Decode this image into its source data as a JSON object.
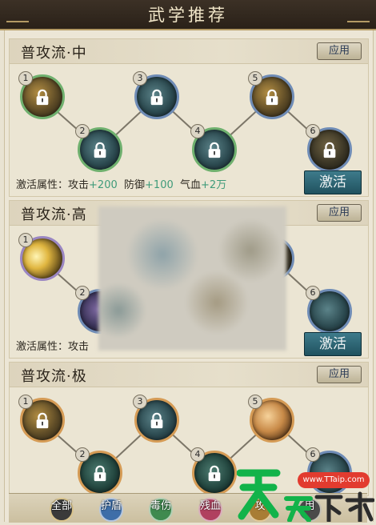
{
  "window": {
    "title": "武学推荐"
  },
  "sections": [
    {
      "title": "普攻流·中",
      "apply_label": "应用",
      "nodes": [
        "1",
        "2",
        "3",
        "4",
        "5",
        "6"
      ],
      "attr_label": "激活属性：",
      "attr_parts": [
        "攻击",
        "+200",
        "防御",
        "+100",
        "气血",
        "+2万"
      ],
      "activate_label": "激活"
    },
    {
      "title": "普攻流·高",
      "apply_label": "应用",
      "nodes": [
        "1",
        "2",
        "6"
      ],
      "attr_label": "激活属性：攻击",
      "activate_label": "激活"
    },
    {
      "title": "普攻流·极",
      "apply_label": "应用",
      "nodes": [
        "1",
        "2",
        "3",
        "4",
        "5",
        "6"
      ]
    }
  ],
  "categories": [
    {
      "label": "全部",
      "color": "#3a3a3a",
      "ring": "#d9c48c"
    },
    {
      "label": "护盾",
      "color": "#3e6ea8",
      "ring": "#b7c7dd"
    },
    {
      "label": "毒伤",
      "color": "#3f8a4f",
      "ring": "#b3d0b5"
    },
    {
      "label": "残血",
      "color": "#b0405f",
      "ring": "#dab0bd"
    },
    {
      "label": "攻",
      "color": "#a87d34",
      "ring": "#e0c99a"
    },
    {
      "label": "用",
      "color": "#4a4a4a",
      "ring": "#c4c0b4"
    }
  ],
  "watermark": {
    "text": "天天下载",
    "url": "www.TTaip.com"
  },
  "colors": {
    "accent_teal": "#2f6f7f",
    "title_bar": "#2f271d",
    "attr_value": "#3f9b7a"
  }
}
